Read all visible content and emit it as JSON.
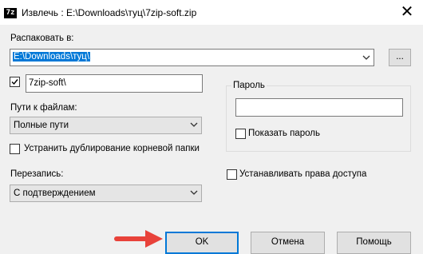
{
  "window": {
    "title": "Извлечь : E:\\Downloads\\туц\\7zip-soft.zip",
    "icon_text": "7z",
    "close_glyph": "✕"
  },
  "extract_to": {
    "label": "Распаковать в:",
    "value": "E:\\Downloads\\туц\\",
    "browse_label": "..."
  },
  "subfolder": {
    "checked": true,
    "value": "7zip-soft\\"
  },
  "paths": {
    "label": "Пути к файлам:",
    "selected": "Полные пути"
  },
  "eliminate_duplicate": {
    "label": "Устранить дублирование корневой папки",
    "checked": false
  },
  "overwrite": {
    "label": "Перезапись:",
    "selected": "С подтверждением"
  },
  "password": {
    "group_label": "Пароль",
    "value": "",
    "show_label": "Показать пароль",
    "show_checked": false
  },
  "access_rights": {
    "label": "Устанавливать права доступа",
    "checked": false
  },
  "buttons": {
    "ok": "OK",
    "cancel": "Отмена",
    "help": "Помощь"
  },
  "colors": {
    "accent": "#0078d7",
    "arrow": "#e8423a"
  },
  "icons": {
    "arrow": "arrow-right-icon",
    "dropdown": "chevron-down-icon",
    "checkmark": "checkmark-icon"
  }
}
